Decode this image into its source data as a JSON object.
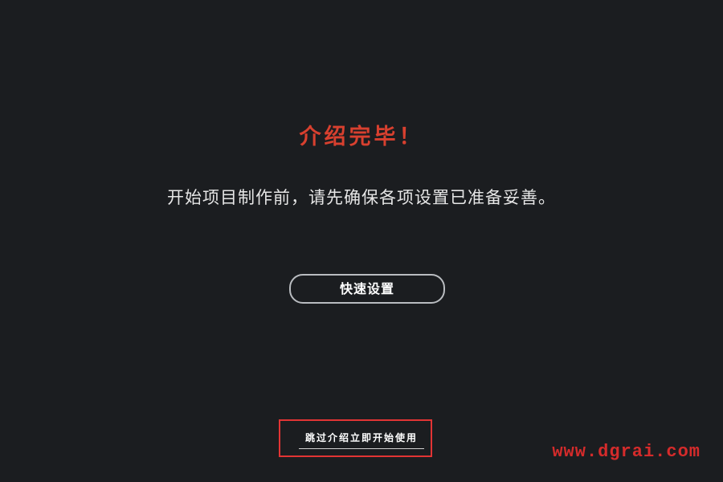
{
  "intro": {
    "title": "介绍完毕！",
    "message": "开始项目制作前，请先确保各项设置已准备妥善。",
    "quick_setup_label": "快速设置",
    "skip_label": "跳过介绍立即开始使用"
  },
  "watermark": {
    "text": "www.dgrai.com"
  },
  "colors": {
    "background": "#1b1d20",
    "title": "#d8402f",
    "highlight_box": "#e23434",
    "button_border": "#b9bcc0"
  }
}
